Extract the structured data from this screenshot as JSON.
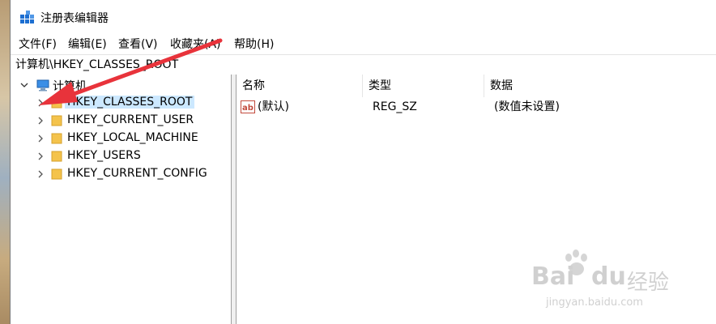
{
  "window": {
    "title": "注册表编辑器"
  },
  "menu": {
    "items": [
      "文件(F)",
      "编辑(E)",
      "查看(V)",
      "收藏夹(A)",
      "帮助(H)"
    ]
  },
  "address_bar": {
    "path": "计算机\\HKEY_CLASSES_ROOT"
  },
  "tree": {
    "root_label": "计算机",
    "keys": [
      {
        "label": "HKEY_CLASSES_ROOT",
        "selected": true
      },
      {
        "label": "HKEY_CURRENT_USER",
        "selected": false
      },
      {
        "label": "HKEY_LOCAL_MACHINE",
        "selected": false
      },
      {
        "label": "HKEY_USERS",
        "selected": false
      },
      {
        "label": "HKEY_CURRENT_CONFIG",
        "selected": false
      }
    ]
  },
  "values_list": {
    "columns": [
      "名称",
      "类型",
      "数据"
    ],
    "rows": [
      {
        "name": "(默认)",
        "type": "REG_SZ",
        "data": "(数值未设置)",
        "icon": "string-value-icon"
      }
    ]
  },
  "annotation": {
    "color": "#e8333b"
  },
  "watermark": {
    "brand": "Bai",
    "brand2": "du",
    "label": "经验",
    "url": "jingyan.baidu.com"
  }
}
